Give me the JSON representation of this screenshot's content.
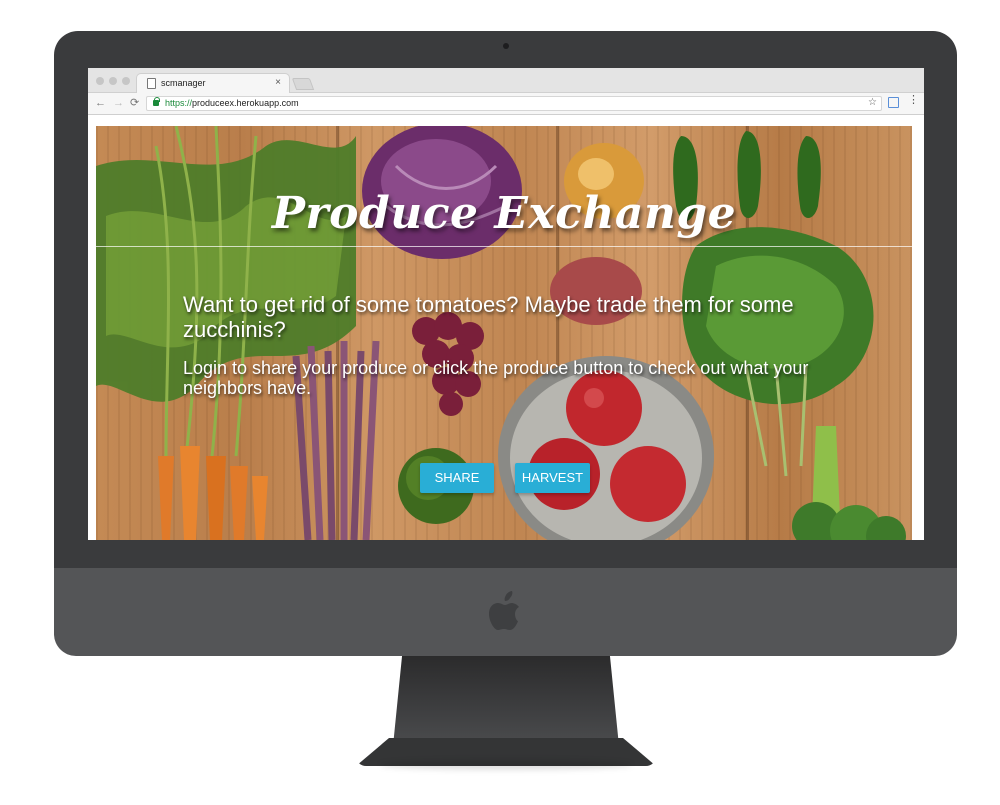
{
  "browser": {
    "tab_title": "scmanager",
    "tab_close": "×",
    "url_scheme": "https://",
    "url_host": "produceex.herokuapp.com",
    "nav": {
      "back": "←",
      "forward": "→",
      "reload": "⟳",
      "bookmark": "☆",
      "menu": "⋮"
    }
  },
  "page": {
    "title": "Produce Exchange",
    "headline": "Want to get rid of some tomatoes? Maybe trade them for some zucchinis?",
    "subline": "Login to share your produce or click the produce button to check out what your neighbors have.",
    "buttons": {
      "share": "SHARE",
      "harvest": "HARVEST"
    }
  },
  "colors": {
    "button": "#29aed6",
    "monitor": "#3a3b3d",
    "chin": "#545557",
    "url_secure": "#1a8a3a"
  }
}
